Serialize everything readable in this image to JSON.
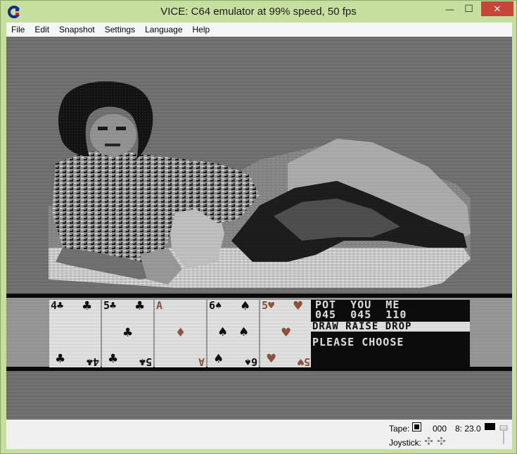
{
  "window": {
    "title": "VICE: C64 emulator at 99% speed, 50 fps",
    "minimize_glyph": "—",
    "maximize_glyph": "☐",
    "close_glyph": "✕",
    "icon": "commodore-logo-icon"
  },
  "menu": {
    "items": [
      "File",
      "Edit",
      "Snapshot",
      "Settings",
      "Language",
      "Help"
    ]
  },
  "game": {
    "cards": [
      {
        "rank": "4",
        "suit": "♣",
        "color": "black"
      },
      {
        "rank": "5",
        "suit": "♣",
        "color": "black"
      },
      {
        "rank": "A",
        "suit": "♦",
        "color": "red"
      },
      {
        "rank": "6",
        "suit": "♠",
        "color": "black"
      },
      {
        "rank": "5",
        "suit": "♥",
        "color": "red"
      }
    ],
    "panel": {
      "headers": "POT  YOU  ME",
      "values": "045  045  110",
      "actions": "DRAW RAISE DROP",
      "status": "PLEASE CHOOSE"
    }
  },
  "statusbar": {
    "tape_label": "Tape:",
    "tape_counter": "000",
    "drive_status": "8: 23.0",
    "joystick_label": "Joystick:"
  },
  "colors": {
    "titlebar": "#c7df9e",
    "close": "#c7463a",
    "card_red": "#9a5a3e"
  }
}
